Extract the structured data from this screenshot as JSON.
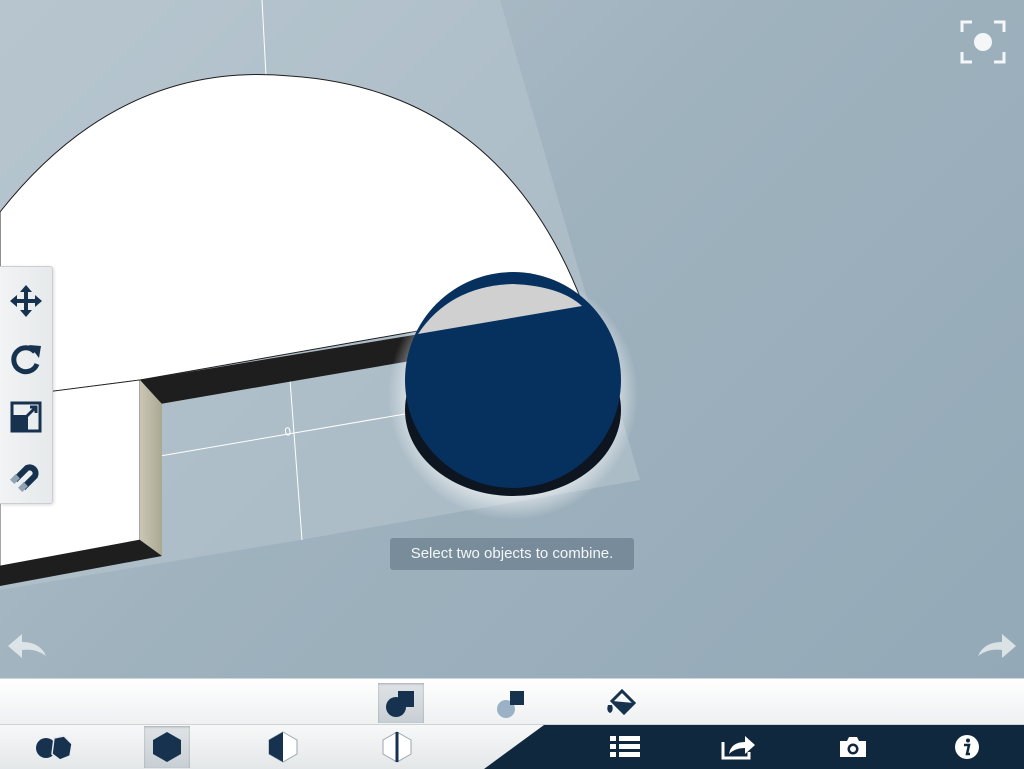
{
  "viewport": {
    "hint_text": "Select two objects to combine.",
    "dimension_label": "0"
  },
  "icons": {
    "top_right": "camera-focus-icon",
    "undo": "undo-arrow-icon",
    "redo": "redo-arrow-icon",
    "left_tools": [
      "move-icon",
      "rotate-icon",
      "scale-icon",
      "magnet-snap-icon"
    ],
    "sub_toolbar": [
      "combine-union-icon",
      "combine-subtract-icon",
      "paint-bucket-icon"
    ],
    "main_toolbar": [
      "shapes-icon",
      "solid-hexagon-icon",
      "half-hexagon-icon",
      "split-hexagon-icon",
      "list-icon",
      "share-icon",
      "camera-icon",
      "info-icon"
    ]
  },
  "colors": {
    "brand_navy": "#06315f",
    "toolbar_dark": "#10283d",
    "icon_navy": "#16324f"
  }
}
